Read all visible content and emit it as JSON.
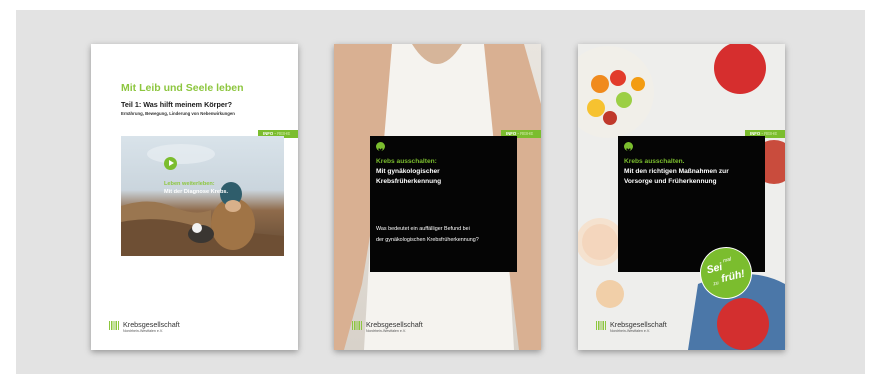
{
  "brochures": [
    {
      "series_info": "INFO",
      "series_reihe": "REIHE",
      "title": "Mit Leib und Seele leben",
      "subtitle": "Teil 1: Was hilft meinem Körper?",
      "subline": "Ernährung, Bewegung, Linderung von Nebenwirkungen",
      "overlay_line1": "Leben weiterleben:",
      "overlay_line2": "Mit der Diagnose Krebs.",
      "logo_name": "Krebsgesellschaft",
      "logo_region": "Nordrhein-Westfalen e.V."
    },
    {
      "series_info": "INFO",
      "series_reihe": "REIHE",
      "headline_green": "Krebs ausschalten:",
      "headline_white": [
        "Mit gynäkologischer",
        "Krebsfrüherkennung"
      ],
      "question": [
        "Was bedeutet ein auffälliger Befund bei",
        "der gynäkologischen Krebsfrüherkennung?"
      ],
      "logo_name": "Krebsgesellschaft",
      "logo_region": "Nordrhein-Westfalen e.V."
    },
    {
      "series_info": "INFO",
      "series_reihe": "REIHE",
      "headline_green": "Krebs ausschalten.",
      "headline_white": [
        "Mit den richtigen Maßnahmen zur",
        "Vorsorge und Früherkennung"
      ],
      "badge": {
        "sei": "Sei",
        "mal": "mal",
        "zu": "zu",
        "frueh": "früh!"
      },
      "logo_name": "Krebsgesellschaft",
      "logo_region": "Nordrhein-Westfalen e.V."
    }
  ],
  "colors": {
    "brand_green": "#7bbd2e",
    "background": "#e3e3e3",
    "box": "#050505"
  },
  "icons": {
    "close": "close-circle-icon",
    "play": "play-icon",
    "logo": "logo-grid-icon"
  }
}
